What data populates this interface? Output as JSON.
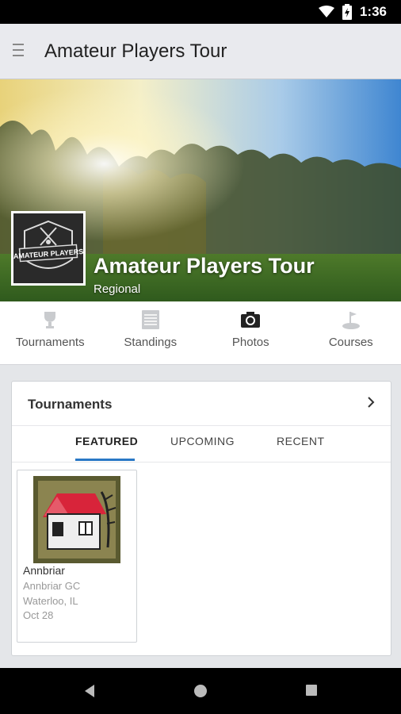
{
  "status_bar": {
    "time": "1:36"
  },
  "app_bar": {
    "title": "Amateur Players Tour"
  },
  "hero": {
    "title": "Amateur Players Tour",
    "subtitle": "Regional",
    "logo_text": "AMATEUR PLAYERS"
  },
  "nav": {
    "items": [
      {
        "label": "Tournaments",
        "icon": "trophy-icon"
      },
      {
        "label": "Standings",
        "icon": "standings-sheet-icon"
      },
      {
        "label": "Photos",
        "icon": "camera-icon"
      },
      {
        "label": "Courses",
        "icon": "golf-flag-icon"
      }
    ]
  },
  "tournaments_card": {
    "title": "Tournaments",
    "tabs": [
      {
        "label": "FEATURED",
        "active": true
      },
      {
        "label": "UPCOMING",
        "active": false
      },
      {
        "label": "RECENT",
        "active": false
      }
    ],
    "items": [
      {
        "name": "Annbriar",
        "course": "Annbriar GC",
        "location": "Waterloo, IL",
        "date": "Oct 28"
      }
    ]
  },
  "colors": {
    "accent": "#2a78c6",
    "app_bar_bg": "#e9eaee",
    "page_bg": "#e4e6e9"
  }
}
